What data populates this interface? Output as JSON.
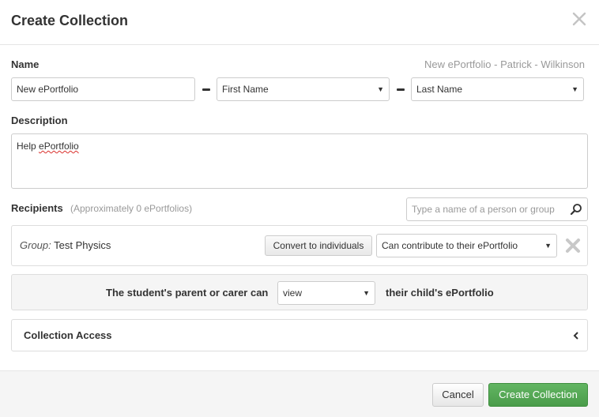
{
  "dialog": {
    "title": "Create Collection"
  },
  "name_section": {
    "label": "Name",
    "preview": "New ePortfolio - Patrick - Wilkinson",
    "name_value": "New ePortfolio",
    "first_select": "First Name",
    "last_select": "Last Name"
  },
  "description": {
    "label": "Description",
    "value_prefix": "Help ",
    "value_misspelled": "ePortfolio"
  },
  "recipients": {
    "label": "Recipients",
    "count_text": "(Approximately 0 ePortfolios)",
    "search_placeholder": "Type a name of a person or group",
    "group": {
      "prefix": "Group:",
      "name": "Test Physics",
      "convert_label": "Convert to individuals",
      "permission": "Can contribute to their ePortfolio"
    }
  },
  "parent_access": {
    "before": "The student's parent or carer can",
    "permission": "view",
    "after": "their child's ePortfolio"
  },
  "collection_access": {
    "label": "Collection Access"
  },
  "footer": {
    "cancel_label": "Cancel",
    "create_label": "Create Collection"
  },
  "colors": {
    "primary_button": "#5cb85c",
    "label_muted": "#999999",
    "remove_icon": "#c8c8c8"
  },
  "icons": [
    "close-icon",
    "dropdown-arrow-icon",
    "search-icon",
    "remove-icon",
    "chevron-left-icon"
  ]
}
